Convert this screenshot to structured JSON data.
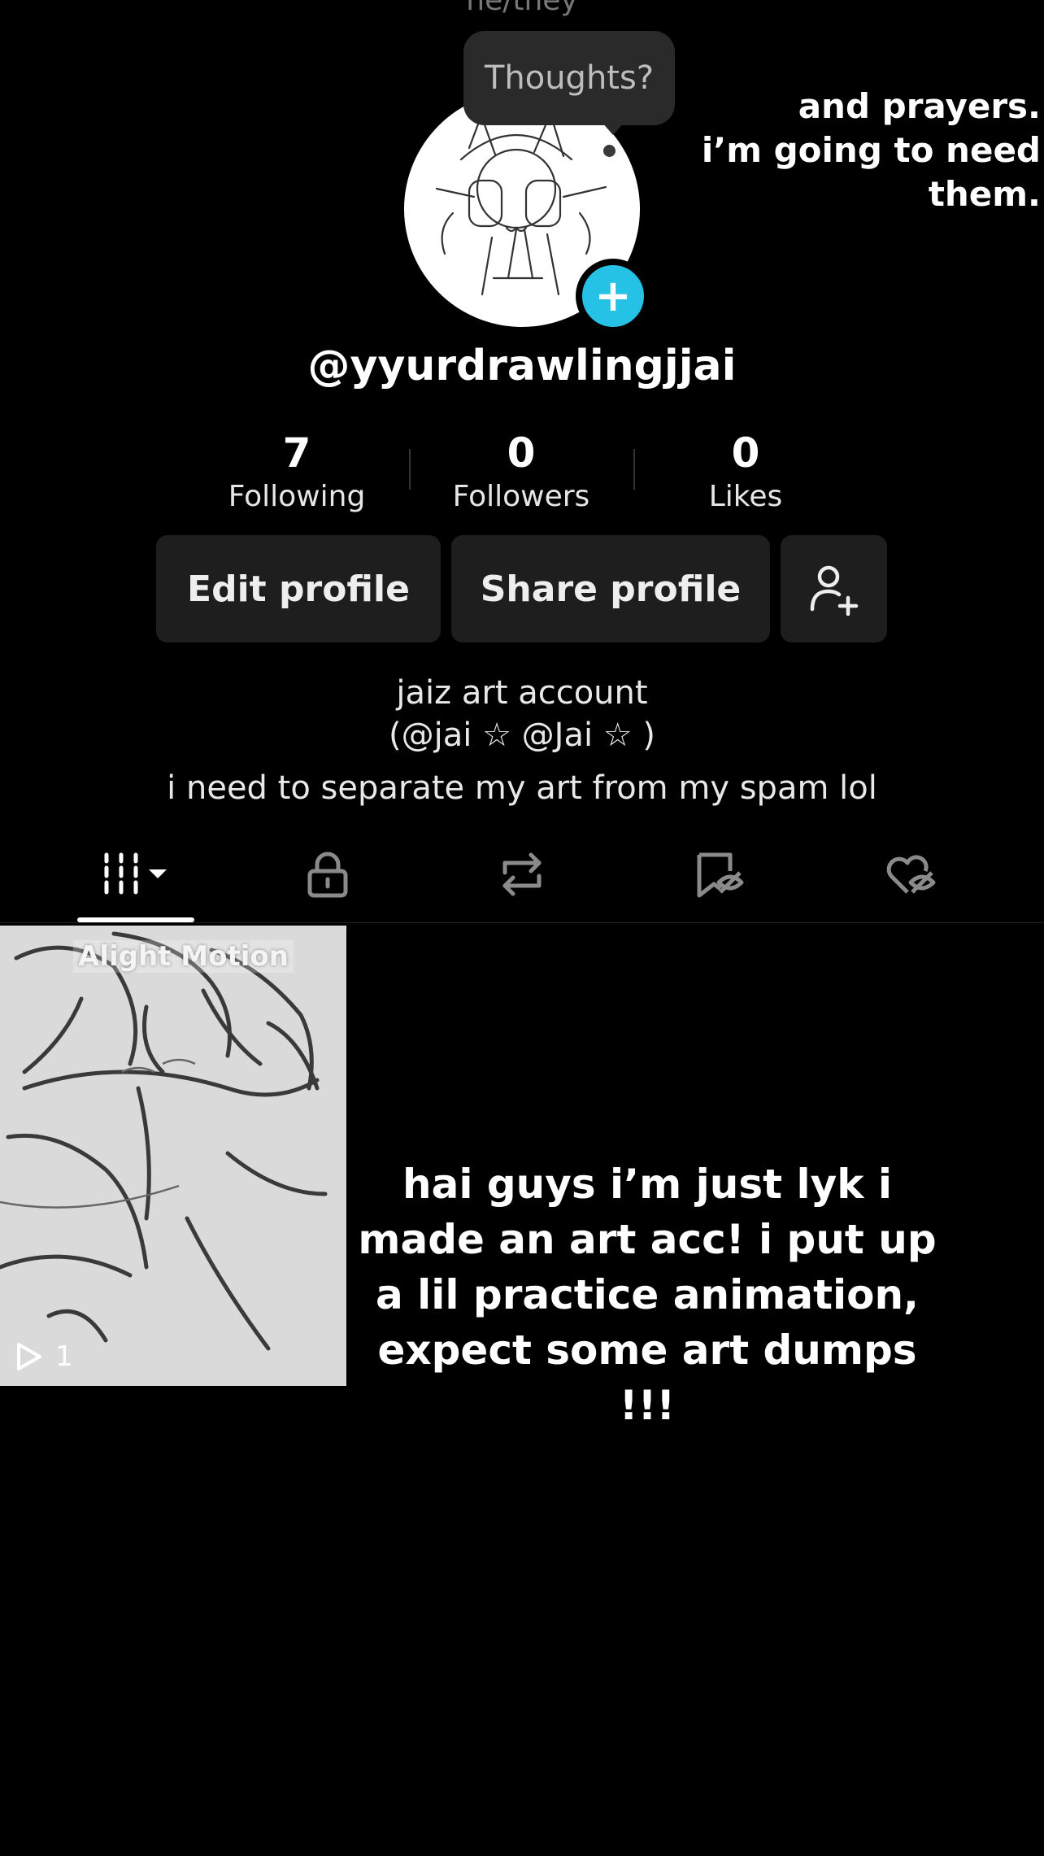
{
  "profile": {
    "pronouns": "he/they",
    "note_bubble": "Thoughts?",
    "note_text_line1": "and prayers.",
    "note_text_line2": "i’m going to need them.",
    "add_icon_glyph": "+",
    "username": "@yyurdrawlingjjai"
  },
  "stats": [
    {
      "value": "7",
      "label": "Following"
    },
    {
      "value": "0",
      "label": "Followers"
    },
    {
      "value": "0",
      "label": "Likes"
    }
  ],
  "buttons": {
    "edit": "Edit profile",
    "share": "Share profile",
    "add_friend_icon": "add-person-icon"
  },
  "bio": {
    "line1": "jaiz art account",
    "line2": "(@jai ☆ @Jai ☆ )",
    "line3": "i need to separate my art from my spam lol"
  },
  "tabs": [
    {
      "icon": "grid-icon",
      "active": true
    },
    {
      "icon": "lock-icon",
      "active": false
    },
    {
      "icon": "repost-icon",
      "active": false
    },
    {
      "icon": "bookmark-hidden-icon",
      "active": false
    },
    {
      "icon": "heart-hidden-icon",
      "active": false
    }
  ],
  "video": {
    "watermark": "Alight Motion",
    "play_count": "1",
    "caption": "hai guys i’m just lyk i made an art acc! i put up a lil practice animation, expect some art dumps !!!"
  },
  "colors": {
    "background": "#000000",
    "button_bg": "#1e1e1e",
    "accent": "#25c2e6"
  }
}
